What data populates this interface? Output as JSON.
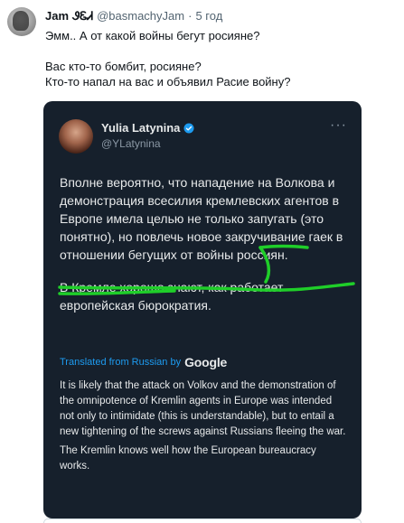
{
  "tweet": {
    "author_name": "Jam",
    "author_flag": "ᏭᏋᏗ",
    "handle": "@basmachyJam",
    "separator": "·",
    "time": "5 год",
    "line1": "Эмм.. А от какой войны бегут росияне?",
    "line2": "Вас кто-то бомбит, росияне?",
    "line3": "Кто-то напал на вас и объявил Расие войну?"
  },
  "quoted": {
    "name": "Yulia Latynina",
    "handle": "@YLatynina",
    "more": "···",
    "paragraph1": "Вполне вероятно, что нападение на Волкова и демонстрация всесилия кремлевских агентов в Европе имела целью не только запугать (это понятно), но повлечь новое закручивание гаек в отношении бегущих от войны россиян.",
    "paragraph2": "В Кремле хорошо знают, как работает европейская бюрократия.",
    "translated_label": "Translated from Russian by",
    "google": "Google",
    "translation1": "It is likely that the attack on Volkov and the demonstration of the omnipotence of Kremlin agents in Europe was intended not only to intimidate (this is understandable), but to entail a new tightening of the screws against Russians fleeing the war.",
    "translation2": "The Kremlin knows well how the European bureaucracy works."
  },
  "colors": {
    "card_bg": "#16202c",
    "accent_blue": "#1d9bf0",
    "highlight_green": "#1fce29"
  },
  "icons": [
    "verified-badge-icon",
    "more-options-icon"
  ]
}
